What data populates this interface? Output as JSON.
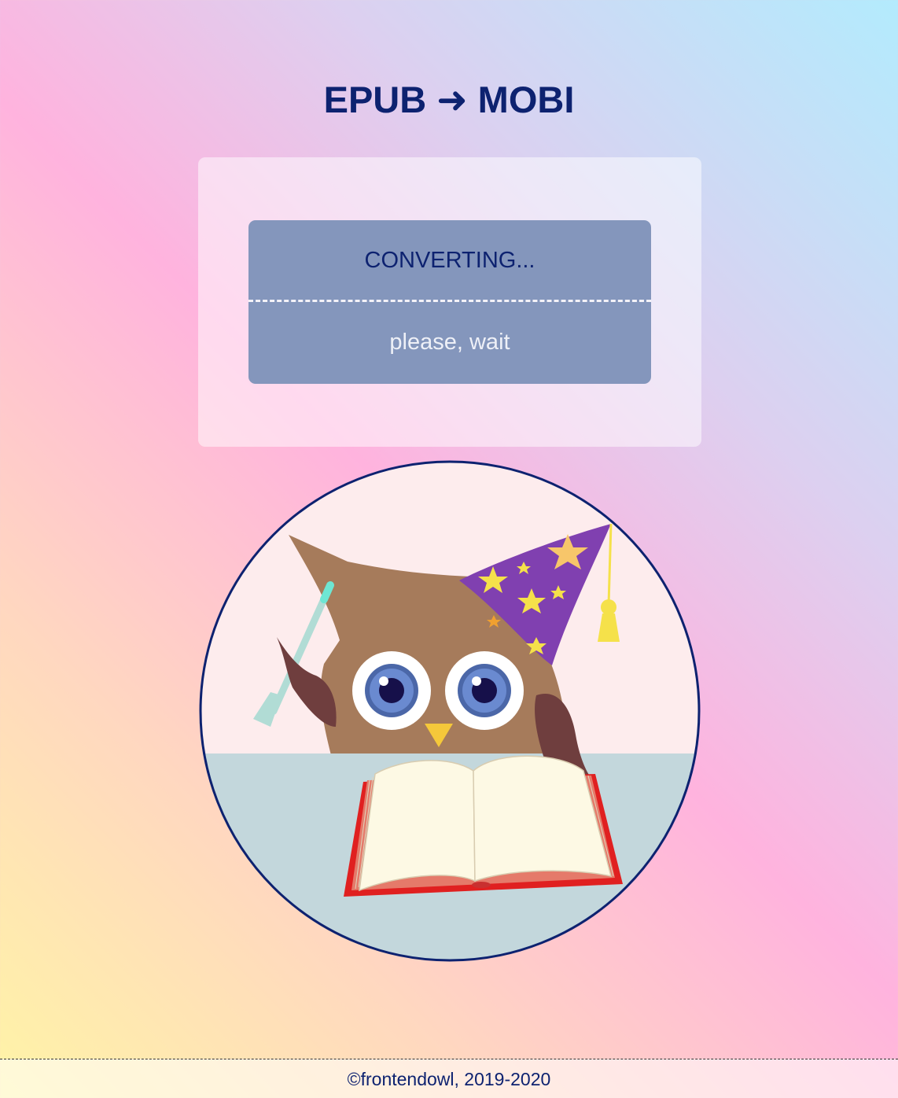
{
  "header": {
    "title": "EPUB ➜ MOBI"
  },
  "status": {
    "title": "CONVERTING...",
    "subtitle": "please, wait"
  },
  "illustration": {
    "subject": "owl-wizard-reading-book"
  },
  "footer": {
    "copyright": "©frontendowl, 2019-2020"
  },
  "colors": {
    "title_text": "#0d2270",
    "status_card": "#8496bc",
    "circle_border": "#0d2270",
    "owl_body": "#a67b5b",
    "wing": "#6f3e3e",
    "hat": "#8040b0",
    "book_cover": "#e02020",
    "table": "#c3d7dc"
  }
}
